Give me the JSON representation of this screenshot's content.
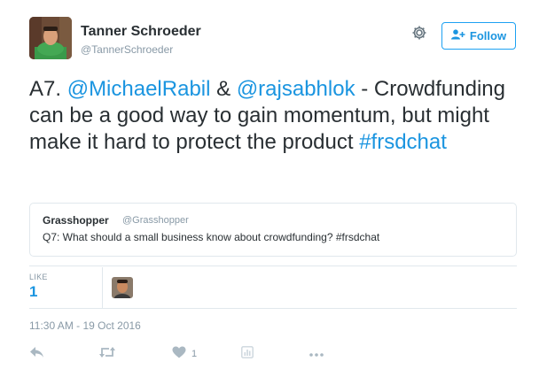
{
  "user": {
    "name": "Tanner Schroeder",
    "handle": "@TannerSchroeder"
  },
  "follow_button": {
    "label": "Follow"
  },
  "tweet": {
    "segments": [
      {
        "text": "A7. ",
        "kind": "text"
      },
      {
        "text": "@MichaelRabil",
        "kind": "mention"
      },
      {
        "text": " & ",
        "kind": "text"
      },
      {
        "text": "@rajsabhlok",
        "kind": "mention"
      },
      {
        "text": " - Crowdfunding can be a good way to gain momentum, but might make it hard to protect the product ",
        "kind": "text"
      },
      {
        "text": "#frsdchat",
        "kind": "hashtag"
      }
    ]
  },
  "quoted_tweet": {
    "name": "Grasshopper",
    "handle": "@Grasshopper",
    "text": "Q7: What should a small business know about crowdfunding? #frsdchat"
  },
  "stats": {
    "like_label": "LIKE",
    "like_count": "1"
  },
  "timestamp": "11:30 AM - 19 Oct 2016",
  "actions": {
    "like_count": "1"
  },
  "colors": {
    "link": "#1b95e0",
    "muted": "#8899a6",
    "border": "#e1e8ed",
    "text": "#292f33"
  },
  "icons": [
    "gear-icon",
    "add-user-icon",
    "reply-icon",
    "retweet-icon",
    "heart-icon",
    "analytics-icon",
    "more-icon"
  ]
}
